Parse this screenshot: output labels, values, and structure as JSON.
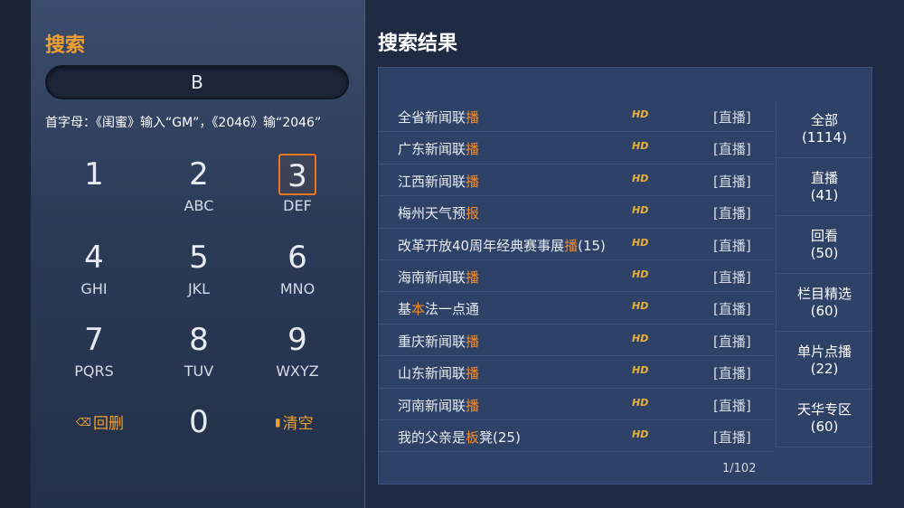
{
  "search": {
    "title": "搜索",
    "input_value": "B",
    "hint": "首字母：《闺蜜》输入“GM”，《2046》输“2046”"
  },
  "keypad": {
    "keys": [
      {
        "num": "1",
        "letters": ""
      },
      {
        "num": "2",
        "letters": "ABC"
      },
      {
        "num": "3",
        "letters": "DEF"
      },
      {
        "num": "4",
        "letters": "GHI"
      },
      {
        "num": "5",
        "letters": "JKL"
      },
      {
        "num": "6",
        "letters": "MNO"
      },
      {
        "num": "7",
        "letters": "PQRS"
      },
      {
        "num": "8",
        "letters": "TUV"
      },
      {
        "num": "9",
        "letters": "WXYZ"
      },
      {
        "num": "0",
        "letters": ""
      }
    ],
    "backspace_label": "回删",
    "clear_label": "清空",
    "focused_key": "3"
  },
  "results": {
    "title": "搜索结果",
    "items": [
      {
        "pre": "全省新闻联",
        "hl": "播",
        "post": "",
        "hd": "HD",
        "tag": "[直播]"
      },
      {
        "pre": "广东新闻联",
        "hl": "播",
        "post": "",
        "hd": "HD",
        "tag": "[直播]"
      },
      {
        "pre": "江西新闻联",
        "hl": "播",
        "post": "",
        "hd": "HD",
        "tag": "[直播]"
      },
      {
        "pre": "梅州天气预",
        "hl": "报",
        "post": "",
        "hd": "HD",
        "tag": "[直播]"
      },
      {
        "pre": "改革开放40周年经典赛事展",
        "hl": "播",
        "post": "(15)",
        "hd": "HD",
        "tag": "[直播]"
      },
      {
        "pre": "海南新闻联",
        "hl": "播",
        "post": "",
        "hd": "HD",
        "tag": "[直播]"
      },
      {
        "pre": "基",
        "hl": "本",
        "post": "法一点通",
        "hd": "HD",
        "tag": "[直播]"
      },
      {
        "pre": "重庆新闻联",
        "hl": "播",
        "post": "",
        "hd": "HD",
        "tag": "[直播]"
      },
      {
        "pre": "山东新闻联",
        "hl": "播",
        "post": "",
        "hd": "HD",
        "tag": "[直播]"
      },
      {
        "pre": "河南新闻联",
        "hl": "播",
        "post": "",
        "hd": "HD",
        "tag": "[直播]"
      },
      {
        "pre": "我的父亲是",
        "hl": "板",
        "post": "凳(25)",
        "hd": "HD",
        "tag": "[直播]"
      }
    ],
    "pager": "1/102"
  },
  "categories": [
    {
      "label": "全部",
      "count": "(1114)"
    },
    {
      "label": "直播",
      "count": "(41)"
    },
    {
      "label": "回看",
      "count": "(50)"
    },
    {
      "label": "栏目精选",
      "count": "(60)"
    },
    {
      "label": "单片点播",
      "count": "(22)"
    },
    {
      "label": "天华专区",
      "count": "(60)"
    }
  ],
  "colors": {
    "accent": "#f0a030",
    "highlight": "#f08a2a",
    "focus_border": "#e8761f",
    "panel": "#2e4268",
    "background": "#1f2b43"
  }
}
